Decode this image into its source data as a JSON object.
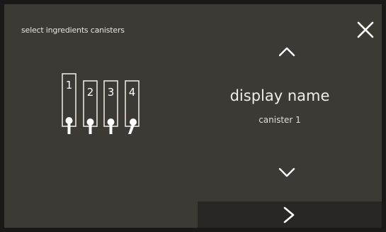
{
  "header": {
    "title": "select ingredients canisters",
    "close_icon": "close-icon"
  },
  "canister_selector": {
    "selected_index": 1,
    "items": [
      {
        "label": "1",
        "selected": true
      },
      {
        "label": "2",
        "selected": false
      },
      {
        "label": "3",
        "selected": false
      },
      {
        "label": "4",
        "selected": false
      }
    ]
  },
  "detail": {
    "heading": "display name",
    "value": "canister 1",
    "up_icon": "chevron-up-icon",
    "down_icon": "chevron-down-icon"
  },
  "footer": {
    "next_icon": "chevron-right-icon"
  },
  "colors": {
    "background": "#3d3935",
    "footer": "#292624",
    "text": "#f1eee9"
  }
}
